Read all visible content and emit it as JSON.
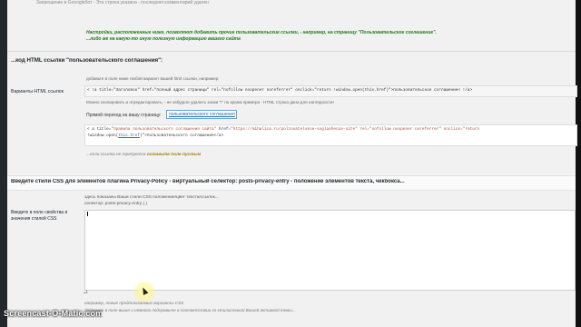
{
  "header": {
    "top_line": "Запрещение в Gooogleбот - Эта строка указана - последняя комментарий удален",
    "green_notes": [
      "Настройки, расположенные ниже, позволяют добавить прочие пользовательские ссылки, - например, на страницу \"Пользовательское соглашение\".",
      "...либо же на какую-то иную полезную информацию вашего сайта"
    ]
  },
  "section_link": {
    "title": "...код HTML ссылки \"пользовательского соглашения\":",
    "label": "Варианты HTML ссылок",
    "hint_top": "добавьте в поле ниже любой вариант вашей html ссылки, например:",
    "code_example": "< !a title=\"Заголовок\" href=\"полный адрес страницы\" rel=\"nofollow noopener noreferrer\" onclick=\"return !window.open(this.href)\">пользовательское соглашение< !/a>",
    "hint_copy": "Можно скопировать и отредактировать, - не забудьте удалить знаки \"!\" по краям примера - HTML строка дана для наглядности!",
    "direct_prefix": "Прямой переход на вашу страницу:",
    "direct_link": "пользовательского соглашения",
    "code_line1_pre": "< a title=",
    "code_line1_str": "\"правила пользовательского соглашения сайта\"",
    "code_line1_mid": " href=",
    "code_line1_url": "\"https://mihalica.ru/polzovatelskoe-soglashenie-site\"",
    "code_line1_rel": " rel=\"nofollow noopener noreferrer\" onclick=\"return",
    "code_line2_pre": "!window.open(",
    "code_line2_link": "this.href",
    "code_line2_post": ")\">пользовательского соглашения</a>",
    "empty_note_prefix": "...если ссылка не требуется",
    "empty_note_bold": "оставьте поле пустым"
  },
  "section_css": {
    "title": "Введите стили CSS для элементов плагина Privacy-Policy - виртуальный селектор: posts-privacy-entry - положение элементов текста, чекбокса...",
    "side_label": "Введите в поле свойства и значения стилей CSS",
    "desc1": "здесь показаны Ваши стили CSS положение/цвет текста/ссылок...",
    "desc2": "селектор: posts-privacy-entry { }",
    "textarea_value": "",
    "bottom1": "например, такие предполагаемые варианты CSS",
    "bottom2": "добавьте в поле выше и немного подправьте в соответствии со стилистикой Вашей активной темы..."
  },
  "watermark": "Screencast-O-Matic.com"
}
